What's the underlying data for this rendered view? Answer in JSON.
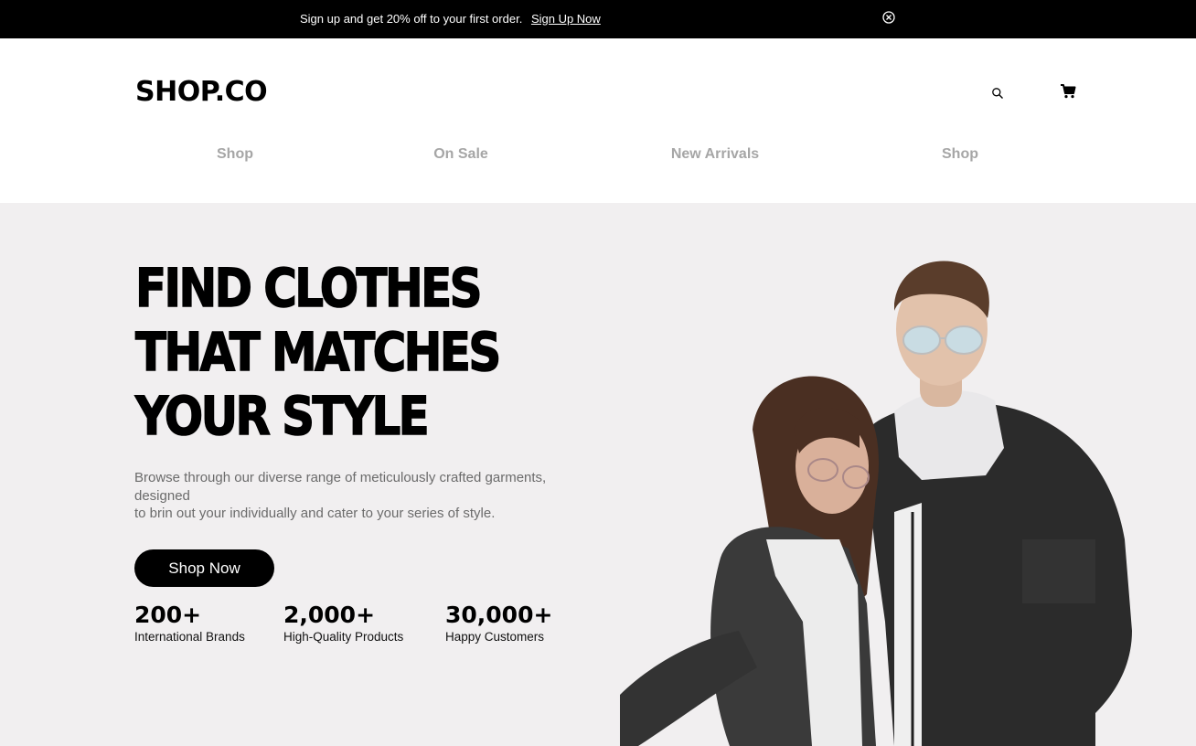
{
  "announcement": {
    "text": "Sign up and get 20% off to your first order.",
    "link_label": "Sign Up Now",
    "close_icon": "close-circle-icon"
  },
  "header": {
    "logo": "SHOP.CO",
    "search_icon": "search-icon",
    "cart_icon": "cart-icon",
    "nav": [
      "Shop",
      "On Sale",
      "New Arrivals",
      "Shop"
    ]
  },
  "hero": {
    "headline": [
      "FIND CLOTHES",
      "THAT MATCHES",
      "YOUR STYLE"
    ],
    "description": [
      "Browse through our diverse range of meticulously crafted garments,",
      "designed",
      "to brin out your individually and cater to your series of style."
    ],
    "cta_label": "Shop Now",
    "stats": [
      {
        "value": "200+",
        "label": "International Brands"
      },
      {
        "value": "2,000+",
        "label": "High-Quality Products"
      },
      {
        "value": "30,000+",
        "label": "Happy Customers"
      }
    ]
  },
  "colors": {
    "topbar_bg": "#000000",
    "hero_bg": "#f1eff0",
    "nav_text": "#a6a6a6",
    "description_text": "#6b6b6b"
  }
}
